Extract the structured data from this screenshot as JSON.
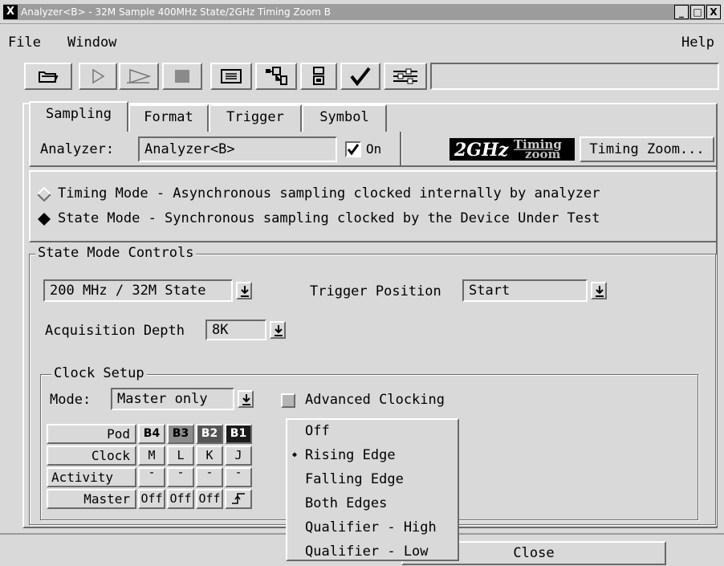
{
  "window": {
    "icon_label": "X",
    "title": "Analyzer<B> - 32M Sample 400MHz State/2GHz Timing Zoom B",
    "controls": [
      "_",
      "□",
      "X"
    ]
  },
  "menu": {
    "file": "File",
    "window": "Window",
    "help": "Help"
  },
  "toolbar": {
    "icons": [
      "open-folder-icon",
      "run-icon",
      "run-repetitive-icon",
      "stop-icon",
      "listing-icon",
      "overview-icon",
      "properties-icon",
      "check-icon",
      "settings-icon"
    ],
    "status_text": ""
  },
  "tabs": [
    "Sampling",
    "Format",
    "Trigger",
    "Symbol"
  ],
  "active_tab": "Sampling",
  "analyzer": {
    "label": "Analyzer:",
    "name": "Analyzer<B>",
    "on_label": "On",
    "on_checked": true,
    "logo_main": "2GHz",
    "logo_timing": "Timing",
    "logo_zoom": "zoom",
    "timing_zoom_button": "Timing Zoom..."
  },
  "sampling_mode": {
    "timing": "Timing Mode - Asynchronous sampling clocked internally by analyzer",
    "state": "State Mode  - Synchronous sampling clocked by the Device Under Test",
    "selected": "state"
  },
  "state_controls": {
    "title": "State Mode Controls",
    "speed": "200 MHz / 32M State",
    "trigger_position_label": "Trigger Position",
    "trigger_position": "Start",
    "acq_depth_label": "Acquisition Depth",
    "acq_depth": "8K"
  },
  "clock_setup": {
    "title": "Clock Setup",
    "mode_label": "Mode:",
    "mode": "Master only",
    "advanced_label": "Advanced Clocking",
    "advanced_checked": false,
    "row_headers": [
      "Pod",
      "Clock",
      "Activity",
      "Master"
    ],
    "pods": [
      "B4",
      "B3",
      "B2",
      "B1"
    ],
    "pod_colors": [
      "#d9d9d9",
      "#8c8c8c",
      "#555555",
      "#1a1a1a"
    ],
    "pod_text_colors": [
      "#000000",
      "#000000",
      "#ffffff",
      "#ffffff"
    ],
    "clocks": [
      "M",
      "L",
      "K",
      "J"
    ],
    "activity": [
      "-",
      "-",
      "-",
      "-"
    ],
    "master": [
      "Off",
      "Off",
      "Off",
      "rising-edge-icon"
    ]
  },
  "edge_menu": {
    "items": [
      "Off",
      "Rising Edge",
      "Falling Edge",
      "Both Edges",
      "Qualifier - High",
      "Qualifier - Low"
    ],
    "selected_index": 1
  },
  "footer": {
    "close": "Close"
  }
}
